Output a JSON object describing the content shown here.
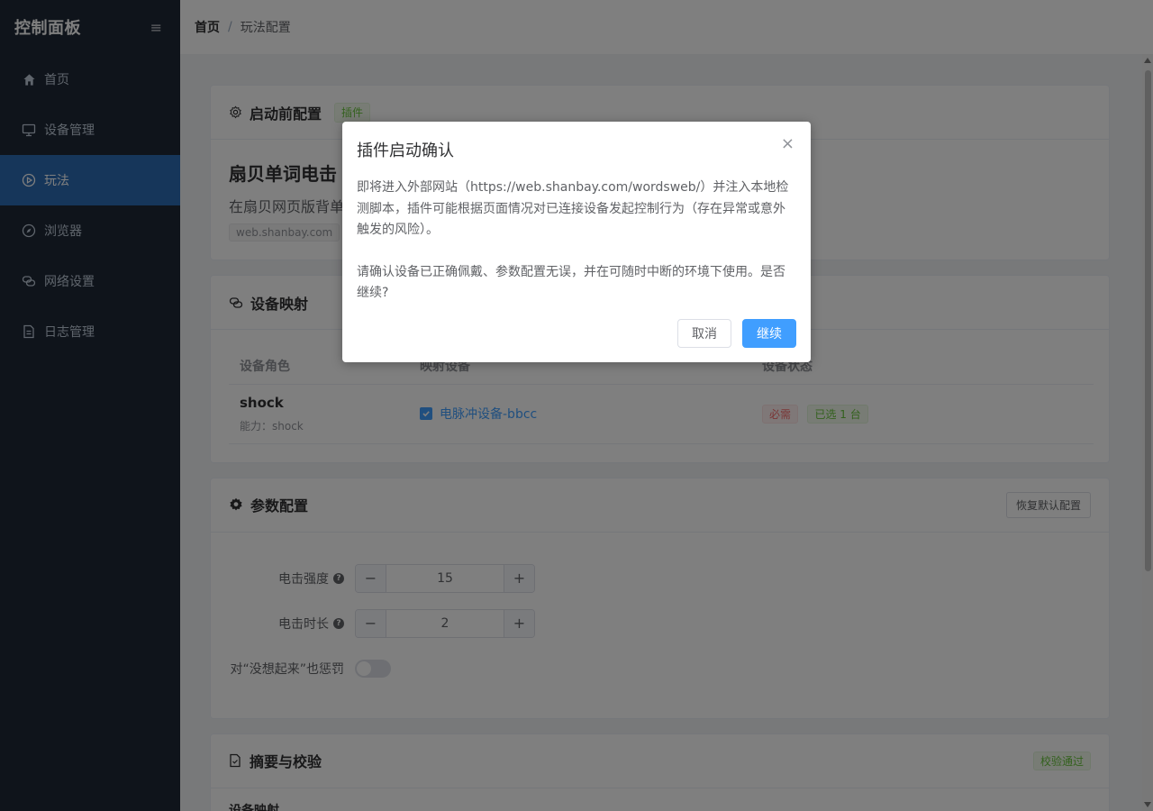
{
  "sidebar": {
    "title": "控制面板",
    "collapse_icon": "≡",
    "items": [
      {
        "label": "首页",
        "icon": "home-icon"
      },
      {
        "label": "设备管理",
        "icon": "monitor-icon"
      },
      {
        "label": "玩法",
        "icon": "play-circle-icon",
        "active": true
      },
      {
        "label": "浏览器",
        "icon": "compass-icon"
      },
      {
        "label": "网络设置",
        "icon": "link-icon"
      },
      {
        "label": "日志管理",
        "icon": "document-icon"
      }
    ]
  },
  "breadcrumb": {
    "home": "首页",
    "separator": "/",
    "current": "玩法配置"
  },
  "prelaunch": {
    "title": "启动前配置",
    "tag": "插件",
    "plugin_name": "扇贝单词电击",
    "plugin_desc": "在扇贝网页版背单",
    "domain": "web.shanbay.com"
  },
  "mapping": {
    "title": "设备映射",
    "columns": [
      "设备角色",
      "映射设备",
      "设备状态"
    ],
    "rows": [
      {
        "role": "shock",
        "capability": "能力：shock",
        "device": "电脉冲设备-bbcc",
        "required": "必需",
        "selected": "已选 1 台"
      }
    ]
  },
  "params": {
    "title": "参数配置",
    "reset_label": "恢复默认配置",
    "fields": [
      {
        "label": "电击强度",
        "value": "15"
      },
      {
        "label": "电击时长",
        "value": "2"
      }
    ],
    "punish_label": "对“没想起来”也惩罚",
    "punish_on": false
  },
  "summary": {
    "title": "摘要与校验",
    "status": "校验通过",
    "partial": "设备映射"
  },
  "dialog": {
    "title": "插件启动确认",
    "close": "×",
    "para1": "即将进入外部网站（https://web.shanbay.com/wordsweb/）并注入本地检测脚本，插件可能根据页面情况对已连接设备发起控制行为（存在异常或意外触发的风险）。",
    "para2": "请确认设备已正确佩戴、参数配置无误，并在可随时中断的环境下使用。是否继续?",
    "cancel": "取消",
    "confirm": "继续"
  },
  "colors": {
    "primary": "#409eff",
    "sidebar_bg": "#1f2937",
    "active_bg": "#2d6db4"
  }
}
